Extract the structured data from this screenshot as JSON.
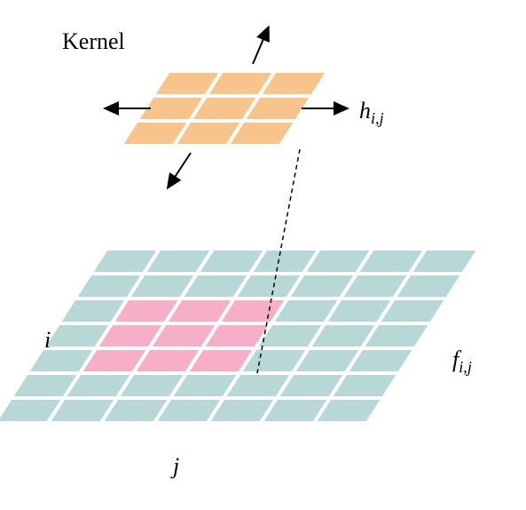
{
  "labels": {
    "title": "Kernel",
    "kernel_symbol": "h",
    "kernel_sub": "i,j",
    "image_symbol": "f",
    "image_sub": "i,j",
    "axis_i": "i",
    "axis_j": "j"
  },
  "colors": {
    "kernel_fill": "#F7C58C",
    "image_fill": "#B8D8D8",
    "highlight_fill": "#F7AFC7",
    "stroke": "#FFFFFF",
    "arrow": "#000000"
  },
  "grid": {
    "image_rows": 7,
    "image_cols": 7,
    "kernel_rows": 3,
    "kernel_cols": 3,
    "highlight_origin_row": 2,
    "highlight_origin_col": 1
  }
}
